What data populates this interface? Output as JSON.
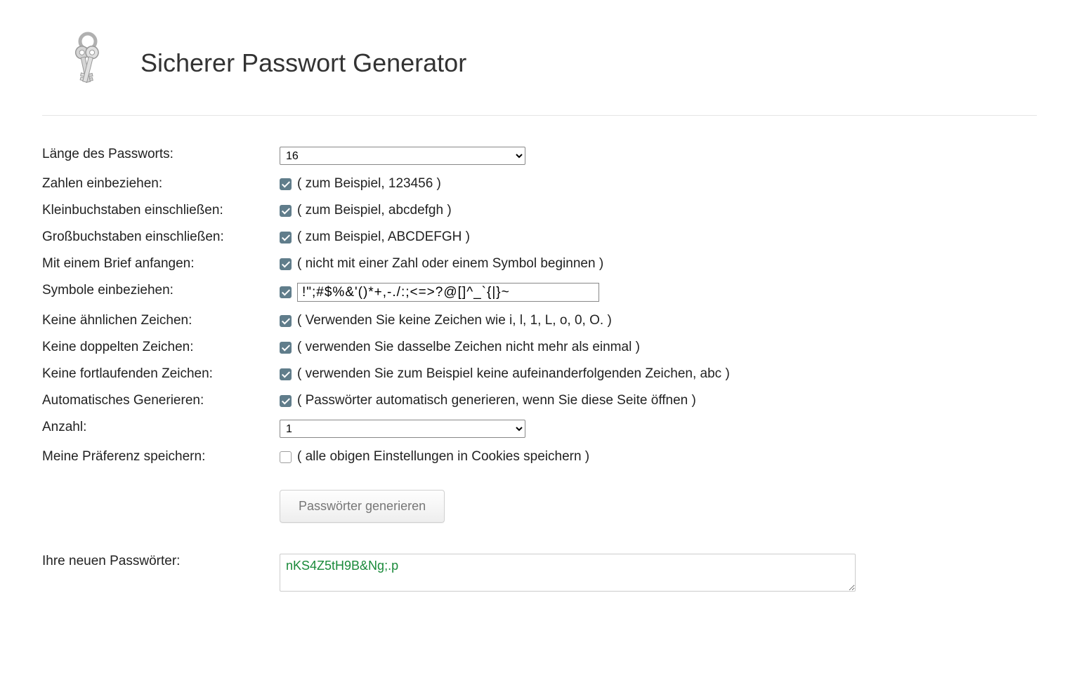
{
  "header": {
    "title": "Sicherer Passwort Generator"
  },
  "labels": {
    "length": "Länge des Passworts:",
    "numbers": "Zahlen einbeziehen:",
    "lowercase": "Kleinbuchstaben einschließen:",
    "uppercase": "Großbuchstaben einschließen:",
    "start_letter": "Mit einem Brief anfangen:",
    "symbols": "Symbole einbeziehen:",
    "no_similar": "Keine ähnlichen Zeichen:",
    "no_duplicates": "Keine doppelten Zeichen:",
    "no_sequential": "Keine fortlaufenden Zeichen:",
    "auto_generate": "Automatisches Generieren:",
    "quantity": "Anzahl:",
    "save_pref": "Meine Präferenz speichern:",
    "output": "Ihre neuen Passwörter:"
  },
  "hints": {
    "numbers": "( zum Beispiel, 123456 )",
    "lowercase": "( zum Beispiel, abcdefgh )",
    "uppercase": "( zum Beispiel, ABCDEFGH )",
    "start_letter": "( nicht mit einer Zahl oder einem Symbol beginnen )",
    "no_similar": "( Verwenden Sie keine Zeichen wie i, l, 1, L, o, 0, O. )",
    "no_duplicates": "( verwenden Sie dasselbe Zeichen nicht mehr als einmal )",
    "no_sequential": "( verwenden Sie zum Beispiel keine aufeinanderfolgenden Zeichen, abc )",
    "auto_generate": "( Passwörter automatisch generieren, wenn Sie diese Seite öffnen )",
    "save_pref": "( alle obigen Einstellungen in Cookies speichern )"
  },
  "values": {
    "length_selected": "16",
    "quantity_selected": "1",
    "symbols_input": "!\";#$%&'()*+,-./:;<=>?@[]^_`{|}~",
    "output": "nKS4Z5tH9B&Ng;.p"
  },
  "checkboxes": {
    "numbers": true,
    "lowercase": true,
    "uppercase": true,
    "start_letter": true,
    "symbols": true,
    "no_similar": true,
    "no_duplicates": true,
    "no_sequential": true,
    "auto_generate": true,
    "save_pref": false
  },
  "buttons": {
    "generate": "Passwörter generieren"
  }
}
